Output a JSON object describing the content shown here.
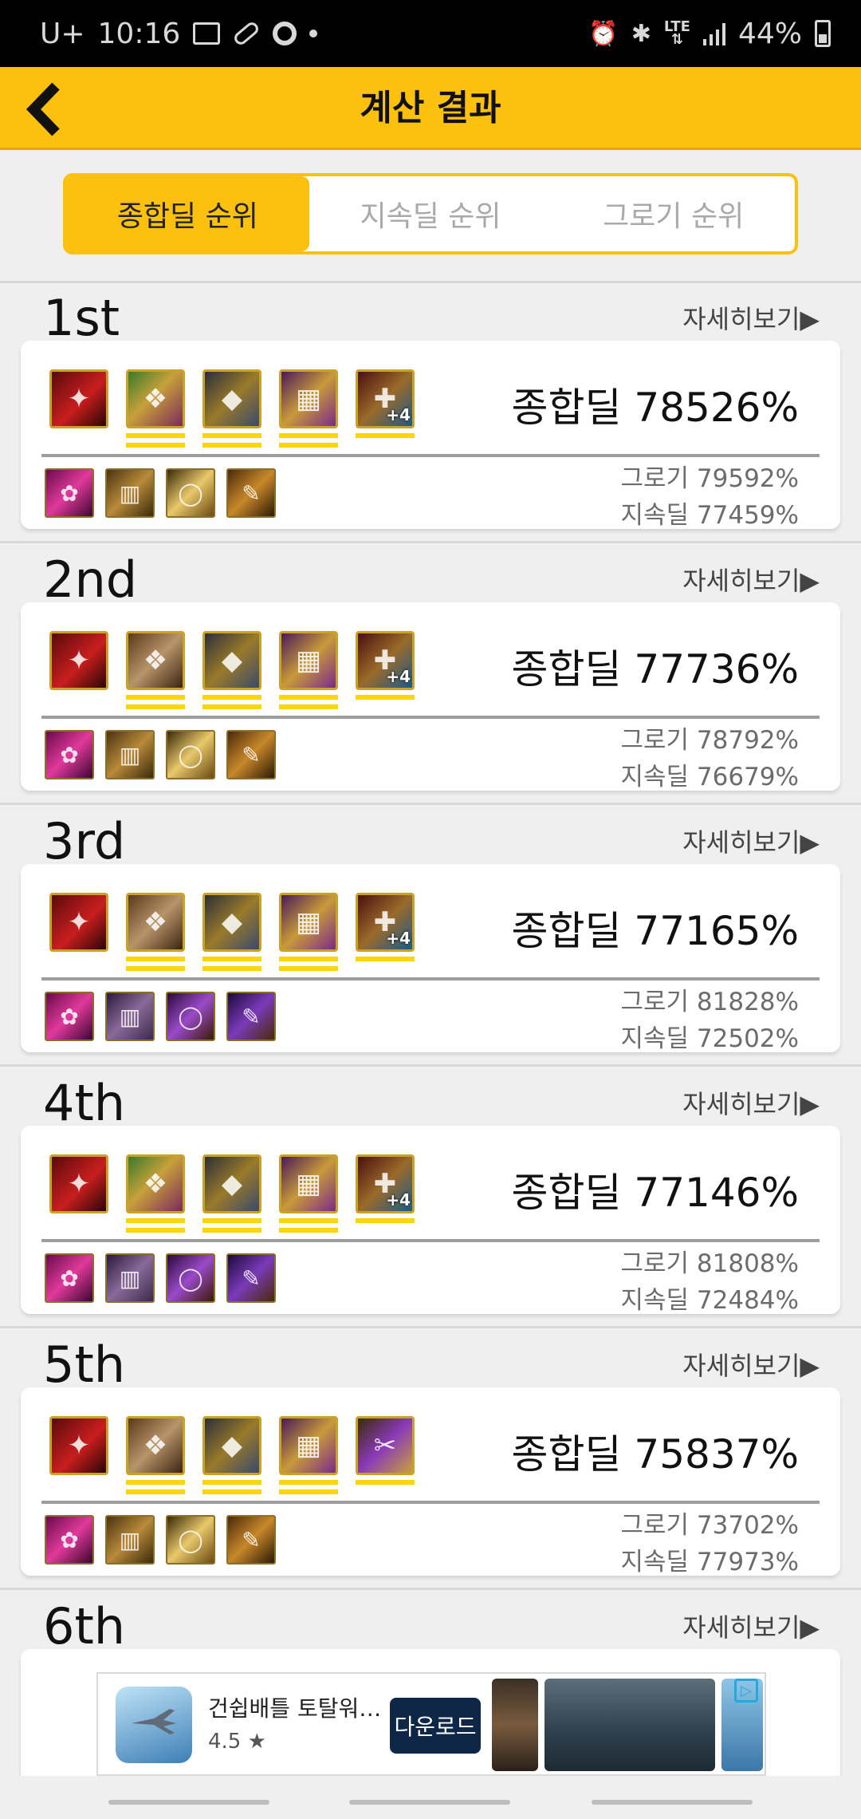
{
  "status_bar": {
    "carrier": "U+",
    "time": "10:16",
    "network": "LTE",
    "battery": "44%"
  },
  "header": {
    "title": "계산 결과"
  },
  "tabs": [
    {
      "label": "종합딜 순위",
      "active": true
    },
    {
      "label": "지속딜 순위",
      "active": false
    },
    {
      "label": "그로기 순위",
      "active": false
    }
  ],
  "detail_label": "자세히보기▶",
  "ranks": [
    {
      "rank": "1st",
      "total": "종합딜 78526%",
      "groggy": "그로기 79592%",
      "sustain": "지속딜 77459%"
    },
    {
      "rank": "2nd",
      "total": "종합딜 77736%",
      "groggy": "그로기 78792%",
      "sustain": "지속딜 76679%"
    },
    {
      "rank": "3rd",
      "total": "종합딜 77165%",
      "groggy": "그로기 81828%",
      "sustain": "지속딜 72502%"
    },
    {
      "rank": "4th",
      "total": "종합딜 77146%",
      "groggy": "그로기 81808%",
      "sustain": "지속딜 72484%"
    },
    {
      "rank": "5th",
      "total": "종합딜 75837%",
      "groggy": "그로기 73702%",
      "sustain": "지속딜 77973%"
    },
    {
      "rank": "6th"
    }
  ],
  "ad": {
    "title": "건쉽배틀 토탈워…",
    "rating": "4.5 ★",
    "button": "다운로드"
  }
}
